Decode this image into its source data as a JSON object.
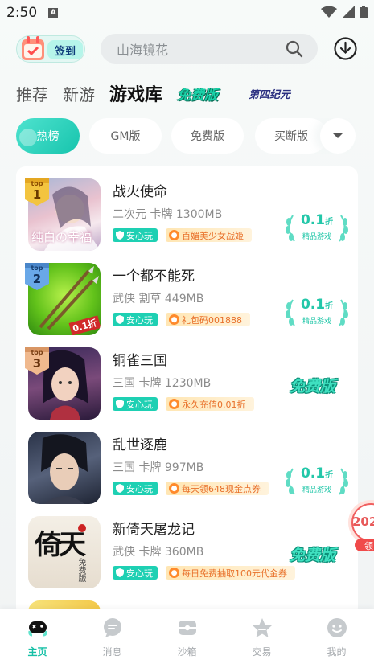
{
  "status": {
    "time": "2:50",
    "a_label": "A"
  },
  "header": {
    "checkin_label": "签到",
    "search_placeholder": "山海镜花"
  },
  "tabs": [
    {
      "label": "推荐"
    },
    {
      "label": "新游"
    },
    {
      "label": "游戏库"
    },
    {
      "label": "免费版"
    },
    {
      "label": "第四纪元"
    }
  ],
  "chips": [
    {
      "label": "热榜"
    },
    {
      "label": "GM版"
    },
    {
      "label": "免费版"
    },
    {
      "label": "买断版"
    }
  ],
  "games": [
    {
      "rank": "1",
      "title": "战火使命",
      "meta": "二次元 卡牌 1300MB",
      "safe": "安心玩",
      "promo": "百媚美少女战姬",
      "discount_value": "0.1",
      "discount_unit": "折",
      "discount_label": "精品游戏",
      "thumb_text": "纯白の幸福"
    },
    {
      "rank": "2",
      "title": "一个都不能死",
      "meta": "武侠 割草 449MB",
      "safe": "安心玩",
      "promo": "礼包码001888",
      "discount_value": "0.1",
      "discount_unit": "折",
      "discount_label": "精品游戏",
      "thumb_text": "0.1折"
    },
    {
      "rank": "3",
      "title": "铜雀三国",
      "meta": "三国 卡牌 1230MB",
      "safe": "安心玩",
      "promo": "永久充值0.01折",
      "free_label": "免费版"
    },
    {
      "title": "乱世逐鹿",
      "meta": "三国 卡牌 997MB",
      "safe": "安心玩",
      "promo": "每天领648现金点券",
      "discount_value": "0.1",
      "discount_unit": "折",
      "discount_label": "精品游戏"
    },
    {
      "title": "新倚天屠龙记",
      "meta": "武侠 卡牌 360MB",
      "safe": "安心玩",
      "promo": "每日免费抽取100元代金券",
      "free_label": "免费版",
      "thumb_text": "倚天",
      "thumb_sub": "免费版"
    }
  ],
  "rank_prefix": "top",
  "float_ad": {
    "text": "202",
    "sub": "领"
  },
  "nav": [
    {
      "label": "主页"
    },
    {
      "label": "消息"
    },
    {
      "label": "沙箱"
    },
    {
      "label": "交易"
    },
    {
      "label": "我的"
    }
  ],
  "colors": {
    "accent": "#1ed0b3",
    "promo": "#e8702a"
  }
}
